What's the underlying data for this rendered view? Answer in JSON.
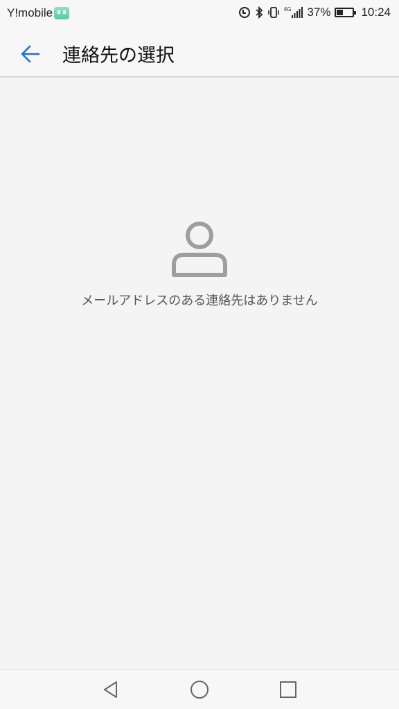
{
  "status_bar": {
    "carrier": "Y!mobile",
    "battery_percent": "37%",
    "battery_level": 0.37,
    "time": "10:24",
    "network_label": "4G"
  },
  "header": {
    "title": "連絡先の選択"
  },
  "empty_state": {
    "message": "メールアドレスのある連絡先はありません"
  },
  "colors": {
    "accent": "#1a73d0",
    "icon_gray": "#9e9e9e",
    "background": "#f4f4f4"
  },
  "icons": {
    "back": "arrow-left-icon",
    "empty": "person-icon",
    "nav_back": "triangle-back-icon",
    "nav_home": "circle-home-icon",
    "nav_recent": "square-recent-icon"
  }
}
